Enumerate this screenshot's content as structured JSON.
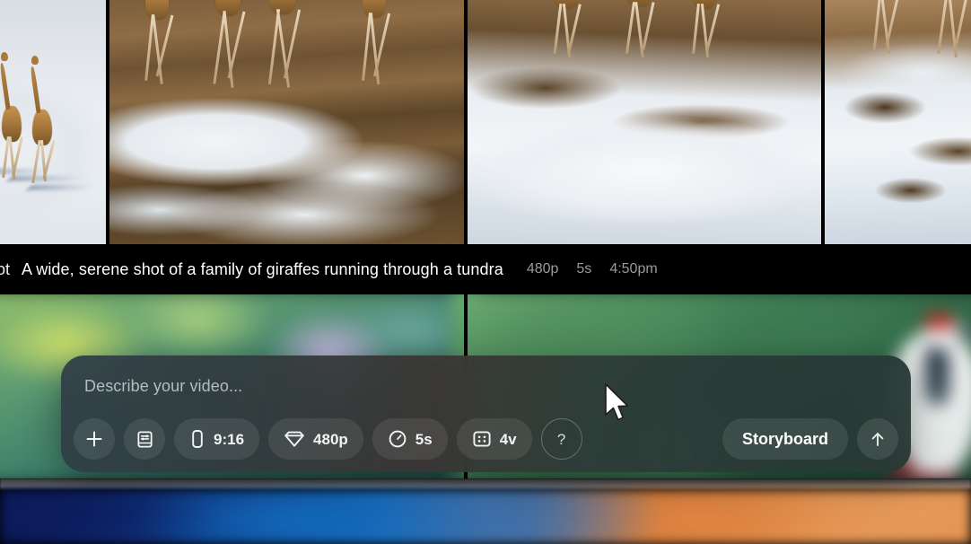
{
  "app": {
    "name": "video-generation-app"
  },
  "video_row_top": {
    "items": [
      {
        "id": "clip-1",
        "scene": "giraffes-running-on-snow-aerial",
        "partial": true
      },
      {
        "id": "clip-2",
        "scene": "giraffes-walking-tundra-snow-patches",
        "partial": false
      },
      {
        "id": "clip-3",
        "scene": "snow-field-with-dark-rock-patches",
        "partial": false
      },
      {
        "id": "clip-4",
        "scene": "giraffe-legs-on-rocky-snow",
        "partial": true
      }
    ]
  },
  "result_meta": {
    "prefix_fragment": "ot",
    "prompt": "A wide, serene shot of a family of giraffes running through a tundra",
    "resolution": "480p",
    "duration": "5s",
    "timestamp": "4:50pm"
  },
  "video_row_bottom": {
    "items": [
      {
        "id": "clip-5",
        "scene": "blurred-green-foliage"
      },
      {
        "id": "clip-6",
        "scene": "blurred-red-crowned-crane"
      }
    ]
  },
  "prompt_bar": {
    "placeholder": "Describe your video...",
    "toolbar": [
      {
        "name": "add-attachment",
        "icon": "plus-icon",
        "label": ""
      },
      {
        "name": "style-reference",
        "icon": "book-settings-icon",
        "label": ""
      },
      {
        "name": "aspect-ratio",
        "icon": "phone-portrait-icon",
        "label": "9:16"
      },
      {
        "name": "resolution",
        "icon": "diamond-icon",
        "label": "480p"
      },
      {
        "name": "duration",
        "icon": "clock-icon",
        "label": "5s"
      },
      {
        "name": "variations",
        "icon": "grid-dots-icon",
        "label": "4v"
      },
      {
        "name": "help",
        "icon": "question-mark-icon",
        "label": "?"
      }
    ],
    "storyboard_label": "Storyboard",
    "send_icon": "arrow-up-icon"
  },
  "colors": {
    "prompt_bar_bg": "#2d3a3c",
    "pill_bg": "rgba(255,255,255,0.085)",
    "text_primary": "#ffffff",
    "text_muted": "#9b9b9b",
    "placeholder": "#b6bcbd",
    "page_bg": "#000000"
  }
}
